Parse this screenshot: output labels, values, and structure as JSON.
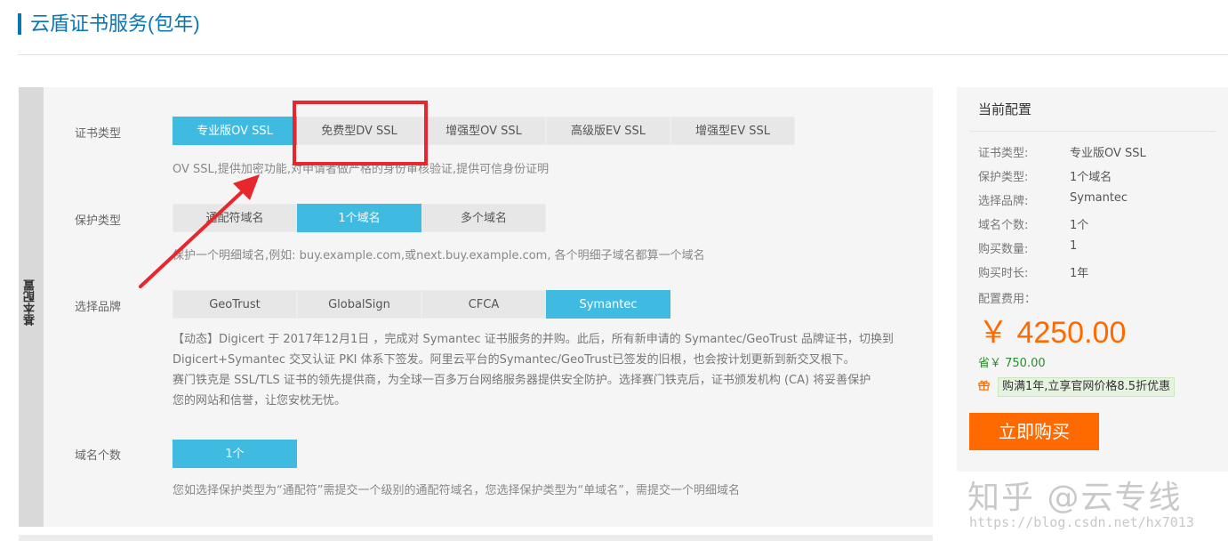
{
  "page": {
    "title": "云盾证书服务(包年)"
  },
  "config": {
    "side_tab": "基本配置",
    "cert_type": {
      "label": "证书类型",
      "options": [
        "专业版OV SSL",
        "免费型DV SSL",
        "增强型OV SSL",
        "高级版EV SSL",
        "增强型EV SSL"
      ],
      "selected": "专业版OV SSL",
      "hint": "OV SSL,提供加密功能,对申请者做严格的身份审核验证,提供可信身份证明"
    },
    "protect_type": {
      "label": "保护类型",
      "options": [
        "通配符域名",
        "1个域名",
        "多个域名"
      ],
      "selected": "1个域名",
      "hint": "保护一个明细域名,例如: buy.example.com,或next.buy.example.com, 各个明细子域名都算一个域名"
    },
    "brand": {
      "label": "选择品牌",
      "options": [
        "GeoTrust",
        "GlobalSign",
        "CFCA",
        "Symantec"
      ],
      "selected": "Symantec",
      "desc_lines": [
        "【动态】Digicert 于 2017年12月1日 ，完成对 Symantec 证书服务的并购。此后，所有新申请的 Symantec/GeoTrust 品牌证书，切换到",
        "Digicert+Symantec 交叉认证 PKI 体系下签发。阿里云平台的Symantec/GeoTrust已签发的旧根，也会按计划更新到新交叉根下。",
        "赛门铁克是 SSL/TLS 证书的领先提供商，为全球一百多万台网络服务器提供安全防护。选择赛门铁克后，证书颁发机构 (CA) 将妥善保护",
        "您的网站和信誉，让您安枕无忧。"
      ]
    },
    "domain_count": {
      "label": "域名个数",
      "options": [
        "1个"
      ],
      "selected": "1个",
      "hint": "您如选择保护类型为“通配符”需提交一个级别的通配符域名，您选择保护类型为“单域名”，需提交一个明细域名"
    }
  },
  "summary": {
    "title": "当前配置",
    "rows": [
      {
        "label": "证书类型:",
        "value": "专业版OV SSL"
      },
      {
        "label": "保护类型:",
        "value": "1个域名"
      },
      {
        "label": "选择品牌:",
        "value": "Symantec"
      },
      {
        "label": "域名个数:",
        "value": "1个"
      },
      {
        "label": "购买数量:",
        "value": "1"
      },
      {
        "label": "购买时长:",
        "value": "1年"
      }
    ],
    "fee_label": "配置费用：",
    "price": "￥ 4250.00",
    "saving": "省￥ 750.00",
    "promo": "购满1年,立享官网价格8.5折优惠",
    "buy_button": "立即购买"
  },
  "watermark": {
    "zhihu": "知乎 @云专线",
    "url": "https://blog.csdn.net/hx7013"
  },
  "colors": {
    "accent": "#3fbbe2",
    "title": "#0a76b5",
    "price": "#ff6a00",
    "annotation": "#e8262e"
  }
}
